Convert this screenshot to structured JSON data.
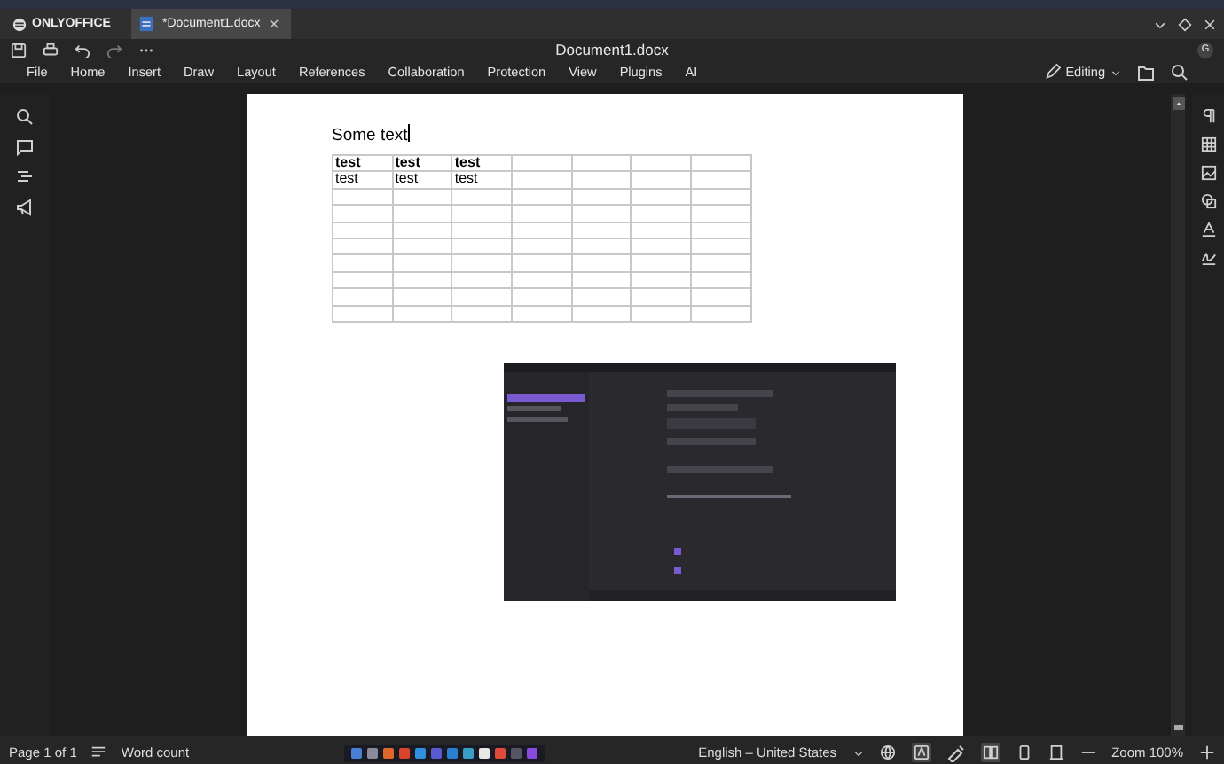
{
  "app": {
    "logo": "ONLYOFFICE"
  },
  "tabs": [
    {
      "label": "*Document1.docx",
      "selected": true
    }
  ],
  "title": "Document1.docx",
  "avatar": "G",
  "menu": [
    "File",
    "Home",
    "Insert",
    "Draw",
    "Layout",
    "References",
    "Collaboration",
    "Protection",
    "View",
    "Plugins",
    "AI"
  ],
  "mode": "Editing",
  "document": {
    "text": "Some text",
    "table": [
      {
        "bold": true,
        "cells": [
          "test",
          "test",
          "test",
          null,
          null,
          null,
          null
        ]
      },
      {
        "bold": false,
        "cells": [
          "test",
          "test",
          "test",
          null,
          null,
          null,
          null
        ]
      },
      {
        "cells": [
          null,
          null,
          null,
          null,
          null,
          null,
          null
        ]
      },
      {
        "cells": [
          null,
          null,
          null,
          null,
          null,
          null,
          null
        ]
      },
      {
        "cells": [
          null,
          null,
          null,
          null,
          null,
          null,
          null
        ]
      },
      {
        "cells": [
          null,
          null,
          null,
          null,
          null,
          null,
          null
        ]
      },
      {
        "cells": [
          null,
          null,
          null,
          null,
          null,
          null,
          null
        ]
      },
      {
        "cells": [
          null,
          null,
          null,
          null,
          null,
          null,
          null
        ]
      },
      {
        "cells": [
          null,
          null,
          null,
          null,
          null,
          null,
          null
        ]
      },
      {
        "cells": [
          null,
          null,
          null,
          null,
          null,
          null,
          null
        ]
      }
    ]
  },
  "status_bar": {
    "page": "Page 1 of 1",
    "word_count": "Word count",
    "language": "English – United States",
    "zoom": "Zoom 100%"
  },
  "taskbar": [
    {
      "color": "#4a7fd6"
    },
    {
      "color": "#8a8a9a"
    },
    {
      "color": "#e0662a"
    },
    {
      "color": "#d9442b"
    },
    {
      "color": "#2f8fe0"
    },
    {
      "color": "#5a5ad0"
    },
    {
      "color": "#2b7fd0"
    },
    {
      "color": "#3aa0c8"
    },
    {
      "color": "#e8e8e8"
    },
    {
      "color": "#e04a3a"
    },
    {
      "color": "#555566"
    },
    {
      "color": "#8a4ae0"
    }
  ]
}
